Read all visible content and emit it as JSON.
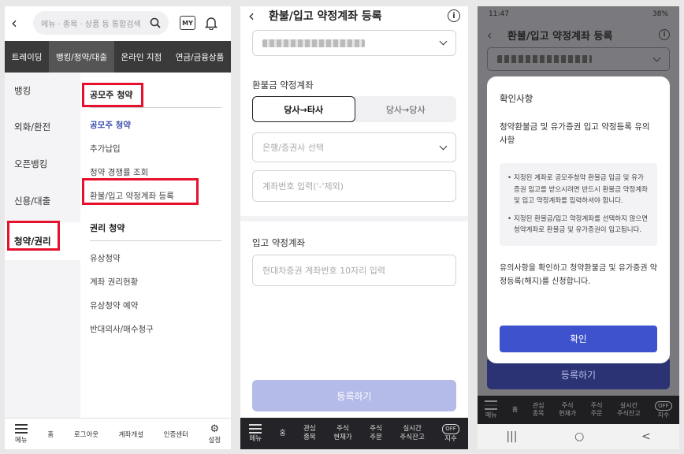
{
  "panel1": {
    "search_placeholder": "메뉴 · 종목 · 상품 등 통합검색",
    "my_label": "MY",
    "tabs": [
      "트레이딩",
      "뱅킹/청약/대출",
      "온라인 지점",
      "연금/금융상품"
    ],
    "side": [
      "뱅킹",
      "외화/환전",
      "오픈뱅킹",
      "신용/대출",
      "청약/권리"
    ],
    "section1_title": "공모주 청약",
    "section1_items": [
      "공모주 청약",
      "추가납입",
      "청약 경쟁률 조회",
      "환불/입고 약정계좌 등록"
    ],
    "section2_title": "권리 청약",
    "section2_items": [
      "유상청약",
      "계좌 권리현황",
      "유상청약 예약",
      "반대의사/매수청구"
    ],
    "bottom": [
      "메뉴",
      "홈",
      "로그아웃",
      "계좌개설",
      "인증센터",
      "설정"
    ]
  },
  "panel2": {
    "title": "환불/입고 약정계좌 등록",
    "refund_label": "환불금 약정계좌",
    "seg_active": "당사→타사",
    "seg_other": "당사→당사",
    "bank_placeholder": "은행/증권사 선택",
    "account_placeholder": "계좌번호 입력('-'제외)",
    "deposit_label": "입고 약정계좌",
    "deposit_placeholder": "현대차증권 계좌번호 10자리 입력",
    "register": "등록하기",
    "nav": [
      "메뉴",
      "홈",
      "관심\n종목",
      "주식\n현재가",
      "주식\n주문",
      "실시간\n주식잔고",
      "지수"
    ],
    "off": "OFF"
  },
  "panel3": {
    "time": "11:47",
    "battery": "38%",
    "title": "환불/입고 약정계좌 등록",
    "modal_title": "확인사항",
    "modal_sub": "청약환불금 및 유가증권 입고 약정등록 유의사항",
    "bullets": [
      "지정된 계좌로 공모주청약 환불금 입금 및 유가증권 입고를 받으시려면 반드시 환불금 약정계좌 및 입고 약정계좌를 입력하셔야 합니다.",
      "지정된 환불금/입고 약정계좌를 선택하지 않으면 청약계좌로 환불금 및 유가증권이 입고됩니다."
    ],
    "footer": "유의사항을 확인하고 청약환불금 및 유가증권 약정등록(해지)를 신청합니다.",
    "confirm": "확인",
    "register": "등록하기",
    "nav": [
      "메뉴",
      "홈",
      "관심\n종목",
      "주식\n현재가",
      "주식\n주문",
      "실시간\n주식잔고",
      "지수"
    ],
    "off": "OFF",
    "sysnav": [
      "|||",
      "○",
      "<"
    ]
  }
}
